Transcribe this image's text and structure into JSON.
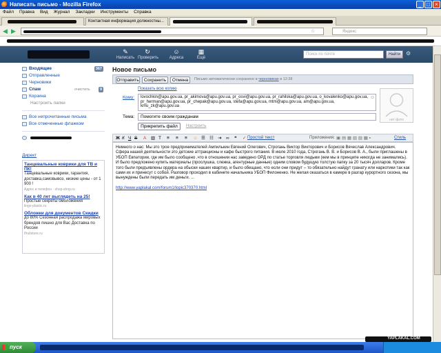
{
  "window": {
    "title": "Написать письмо - Mozilla Firefox"
  },
  "menu": [
    "Файл",
    "Правка",
    "Вид",
    "Журнал",
    "Закладки",
    "Инструменты",
    "Справка"
  ],
  "tabs": [
    {
      "label": "",
      "active": false
    },
    {
      "label": "Контактная информация должностны...",
      "active": false
    },
    {
      "label": "",
      "active": true
    },
    {
      "label": "",
      "active": false
    }
  ],
  "browser": {
    "search_placeholder": "Яндекс"
  },
  "mail": {
    "header": {
      "compose": "Написать",
      "check": "Проверить",
      "addresses": "Адреса",
      "more": "Ещё",
      "search_placeholder": "Поиск по почте",
      "find": "Найти"
    },
    "folders": [
      {
        "label": "Входящие",
        "count": "367",
        "bold": true
      },
      {
        "label": "Отправленные"
      },
      {
        "label": "Черновики"
      },
      {
        "label": "Спам",
        "action": "очистить",
        "count": "9",
        "bold": true
      },
      {
        "label": "Корзина"
      }
    ],
    "folder_settings": "Настроить папки",
    "all_unread": "Все непрочитанные письма",
    "all_flagged": "Все отмеченные флажком",
    "direct": "Директ",
    "ads": [
      {
        "title": "Танцевальные коврики для ТВ и ПК!",
        "desc": "Танцевальные коврики, гарантия, доставка,самовывоз, низкие цены - от 1 900 !",
        "src": "Адрес и телефон · shop-shop.ru"
      },
      {
        "title": "Как в 40 лет выглядеть на 25!",
        "desc": "Простые секреты омоложения",
        "src": "lingo-plastic.ru"
      },
      {
        "title": "Обложки для документов Скидки",
        "desc": "до 80% Сезонная распродажа мировых брендов пишно для Вас Доставка по России",
        "src": "Ifruitstore.ru"
      }
    ],
    "compose": {
      "title": "Новое письмо",
      "send": "Отправить",
      "save": "Сохранить",
      "cancel": "Отмена",
      "autosave": "Письмо автоматически сохранено в",
      "autosave_link": "черновиках",
      "autosave_time": "в 12:38",
      "show_all": "Показать всю копию",
      "to_label": "Кому:",
      "to_value": "lovochkin@apu.gov.ua, pr_akimova@apu.gov.ua, pr_osvi@apu.gov.ua, pr_rahilska@apu.gov.ua, o_kovalenko@apu.gov.ua, pr_herman@apu.gov.ua, pr_chepak@apu.gov.ua, stefa@apu.gov.ua, mtm@apu.gov.ua, am@apu.gov.ua, kmu_zk@apu.gov.ua",
      "subject_label": "Тема:",
      "subject_value": "Помогите своим гражданам",
      "attach": "Прикрепить файл",
      "configure": "Настроить",
      "no_photo": "нет фото",
      "plain_text": "Простой текст",
      "attachments_label": "Приложения:",
      "style": "Стиль",
      "body": "Немного о нас: Мы это трое предпринимателей Ампилькин Евгений Олегович, Строгань Виктор Викторович и Борисов Вячеслав Александрович. Сфера нашей деятельности это детские аттракционы и кафе быстрого питания. В июле 2010 года, Строгань В. В. и Борисов В. А., были приглашены в УБОП Евпатории, где им было сообщено ,что в отношении нас заведено ОРД по статье торговля людьми (кем мы в принципе никогда не занимались). И было предложено купить материалы (прослушка, слежка, агентурные данные) одним словом будущую толстую папку за 20 тысяч долларов. Кроме того были предъявлены ордера на обыски наших квартир, и было обещано, что если они придут – то обязательно найдут гранату или наркотики так как сами их и принесут с собой. Разговор проходил в кабинете начальника УБОП Филоненко. Не желая оказаться в камере в разгар курортного сезона, мы вынуждены были передать им деньги. ...",
      "link": "http://www.yaplakal.com/forum1/topic370370.html"
    }
  },
  "taskbar": {
    "start": "пуск"
  },
  "watermark": "YAPLAKAL.COM"
}
